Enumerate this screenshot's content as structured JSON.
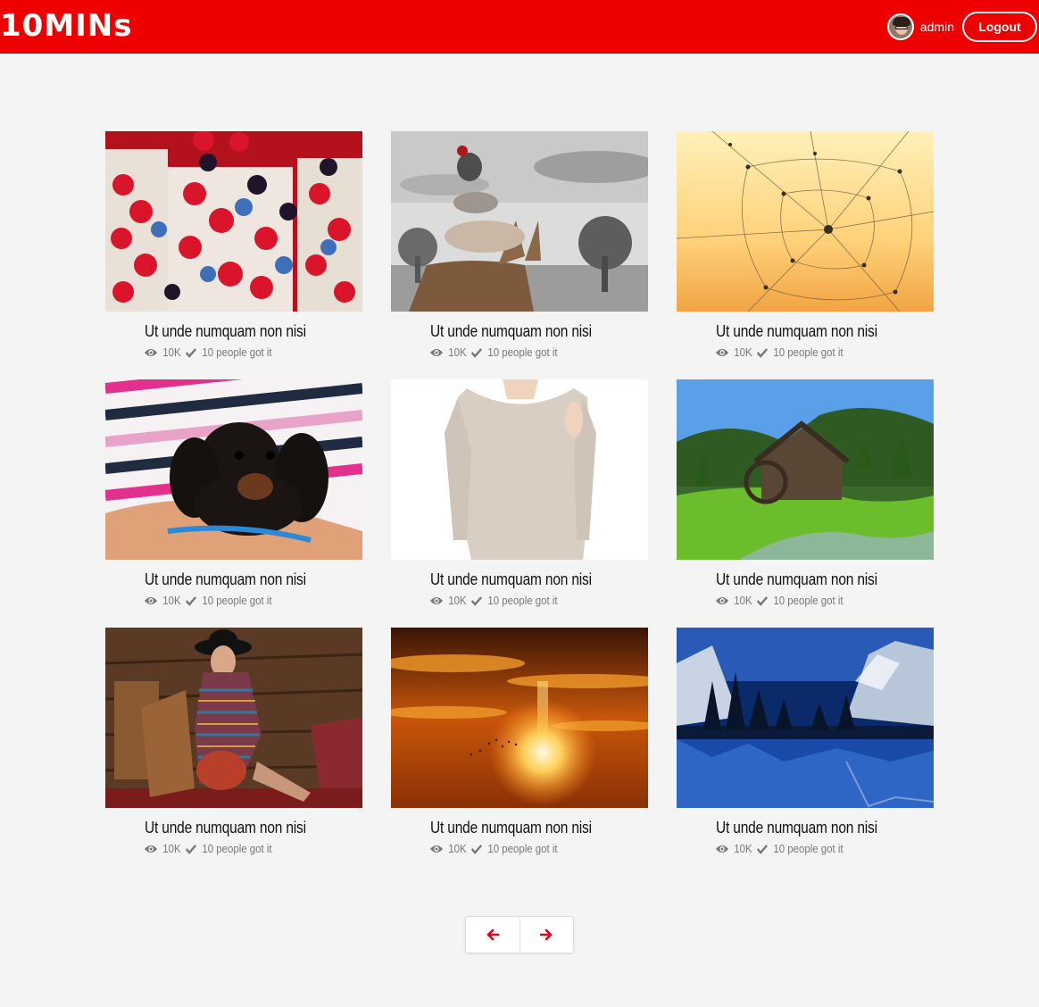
{
  "header": {
    "logo": "10MINs",
    "username": "admin",
    "logout_label": "Logout",
    "brand_color": "#ee0000"
  },
  "cards": [
    {
      "title": "Ut unde numquam non nisi",
      "views": "10K",
      "got_it": "10 people got it",
      "image": "berries-photo"
    },
    {
      "title": "Ut unde numquam non nisi",
      "views": "10K",
      "got_it": "10 people got it",
      "image": "animals-stack-photo"
    },
    {
      "title": "Ut unde numquam non nisi",
      "views": "10K",
      "got_it": "10 people got it",
      "image": "spider-web-dew-photo"
    },
    {
      "title": "Ut unde numquam non nisi",
      "views": "10K",
      "got_it": "10 people got it",
      "image": "dachshund-puppy-photo"
    },
    {
      "title": "Ut unde numquam non nisi",
      "views": "10K",
      "got_it": "10 people got it",
      "image": "beige-top-photo"
    },
    {
      "title": "Ut unde numquam non nisi",
      "views": "10K",
      "got_it": "10 people got it",
      "image": "watermill-photo"
    },
    {
      "title": "Ut unde numquam non nisi",
      "views": "10K",
      "got_it": "10 people got it",
      "image": "fashion-woman-photo"
    },
    {
      "title": "Ut unde numquam non nisi",
      "views": "10K",
      "got_it": "10 people got it",
      "image": "sunset-photo"
    },
    {
      "title": "Ut unde numquam non nisi",
      "views": "10K",
      "got_it": "10 people got it",
      "image": "mountain-lake-photo"
    }
  ],
  "pagination": {
    "prev_icon": "arrow-left-icon",
    "next_icon": "arrow-right-icon",
    "accent": "#e3001b"
  }
}
